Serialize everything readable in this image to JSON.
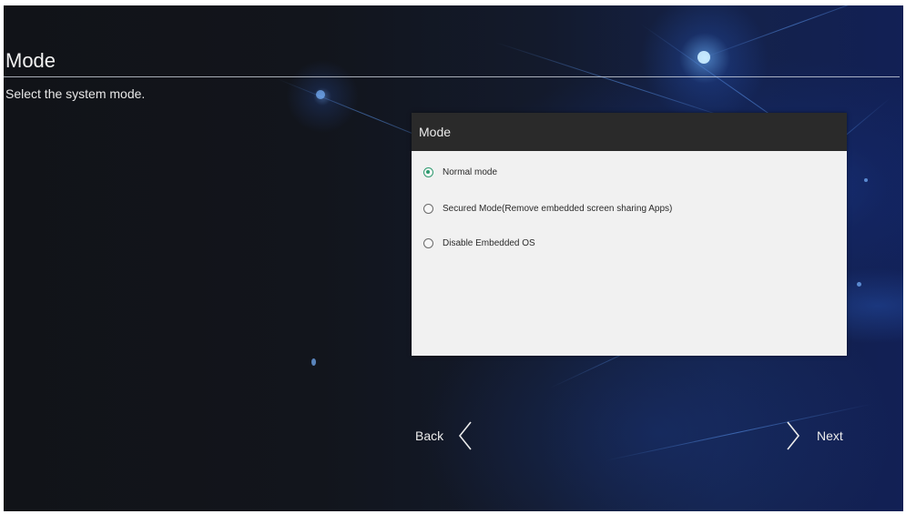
{
  "page": {
    "title": "Mode",
    "subtitle": "Select the system mode."
  },
  "dialog": {
    "title": "Mode",
    "options": [
      {
        "label": "Normal mode",
        "selected": true
      },
      {
        "label": "Secured Mode(Remove embedded screen sharing Apps)",
        "selected": false
      },
      {
        "label": "Disable Embedded OS",
        "selected": false
      }
    ]
  },
  "navigation": {
    "back_label": "Back",
    "back_icon": "chevron-left-icon",
    "next_label": "Next",
    "next_icon": "chevron-right-icon"
  },
  "colors": {
    "accent": "#2e9a6f",
    "dialog_header": "#2a2a2a",
    "dialog_body": "#f1f1f1",
    "background": "#121a2c"
  }
}
